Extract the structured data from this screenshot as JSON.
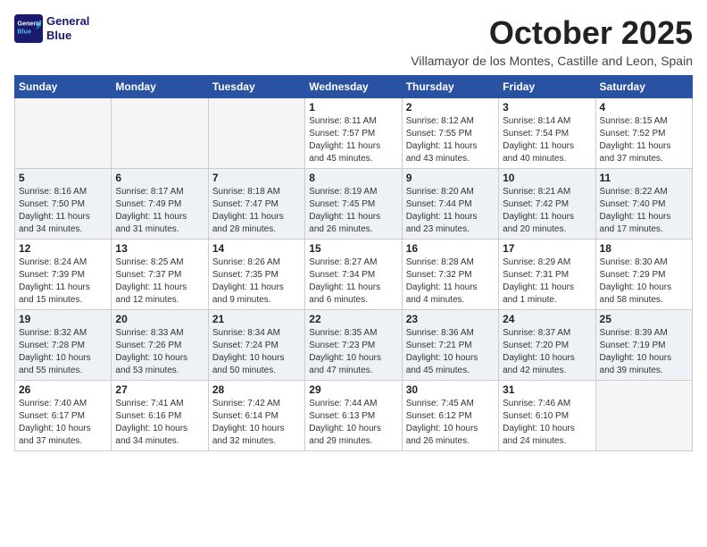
{
  "header": {
    "logo_line1": "General",
    "logo_line2": "Blue",
    "month_title": "October 2025",
    "subtitle": "Villamayor de los Montes, Castille and Leon, Spain"
  },
  "weekdays": [
    "Sunday",
    "Monday",
    "Tuesday",
    "Wednesday",
    "Thursday",
    "Friday",
    "Saturday"
  ],
  "weeks": [
    [
      {
        "day": "",
        "info": ""
      },
      {
        "day": "",
        "info": ""
      },
      {
        "day": "",
        "info": ""
      },
      {
        "day": "1",
        "info": "Sunrise: 8:11 AM\nSunset: 7:57 PM\nDaylight: 11 hours\nand 45 minutes."
      },
      {
        "day": "2",
        "info": "Sunrise: 8:12 AM\nSunset: 7:55 PM\nDaylight: 11 hours\nand 43 minutes."
      },
      {
        "day": "3",
        "info": "Sunrise: 8:14 AM\nSunset: 7:54 PM\nDaylight: 11 hours\nand 40 minutes."
      },
      {
        "day": "4",
        "info": "Sunrise: 8:15 AM\nSunset: 7:52 PM\nDaylight: 11 hours\nand 37 minutes."
      }
    ],
    [
      {
        "day": "5",
        "info": "Sunrise: 8:16 AM\nSunset: 7:50 PM\nDaylight: 11 hours\nand 34 minutes."
      },
      {
        "day": "6",
        "info": "Sunrise: 8:17 AM\nSunset: 7:49 PM\nDaylight: 11 hours\nand 31 minutes."
      },
      {
        "day": "7",
        "info": "Sunrise: 8:18 AM\nSunset: 7:47 PM\nDaylight: 11 hours\nand 28 minutes."
      },
      {
        "day": "8",
        "info": "Sunrise: 8:19 AM\nSunset: 7:45 PM\nDaylight: 11 hours\nand 26 minutes."
      },
      {
        "day": "9",
        "info": "Sunrise: 8:20 AM\nSunset: 7:44 PM\nDaylight: 11 hours\nand 23 minutes."
      },
      {
        "day": "10",
        "info": "Sunrise: 8:21 AM\nSunset: 7:42 PM\nDaylight: 11 hours\nand 20 minutes."
      },
      {
        "day": "11",
        "info": "Sunrise: 8:22 AM\nSunset: 7:40 PM\nDaylight: 11 hours\nand 17 minutes."
      }
    ],
    [
      {
        "day": "12",
        "info": "Sunrise: 8:24 AM\nSunset: 7:39 PM\nDaylight: 11 hours\nand 15 minutes."
      },
      {
        "day": "13",
        "info": "Sunrise: 8:25 AM\nSunset: 7:37 PM\nDaylight: 11 hours\nand 12 minutes."
      },
      {
        "day": "14",
        "info": "Sunrise: 8:26 AM\nSunset: 7:35 PM\nDaylight: 11 hours\nand 9 minutes."
      },
      {
        "day": "15",
        "info": "Sunrise: 8:27 AM\nSunset: 7:34 PM\nDaylight: 11 hours\nand 6 minutes."
      },
      {
        "day": "16",
        "info": "Sunrise: 8:28 AM\nSunset: 7:32 PM\nDaylight: 11 hours\nand 4 minutes."
      },
      {
        "day": "17",
        "info": "Sunrise: 8:29 AM\nSunset: 7:31 PM\nDaylight: 11 hours\nand 1 minute."
      },
      {
        "day": "18",
        "info": "Sunrise: 8:30 AM\nSunset: 7:29 PM\nDaylight: 10 hours\nand 58 minutes."
      }
    ],
    [
      {
        "day": "19",
        "info": "Sunrise: 8:32 AM\nSunset: 7:28 PM\nDaylight: 10 hours\nand 55 minutes."
      },
      {
        "day": "20",
        "info": "Sunrise: 8:33 AM\nSunset: 7:26 PM\nDaylight: 10 hours\nand 53 minutes."
      },
      {
        "day": "21",
        "info": "Sunrise: 8:34 AM\nSunset: 7:24 PM\nDaylight: 10 hours\nand 50 minutes."
      },
      {
        "day": "22",
        "info": "Sunrise: 8:35 AM\nSunset: 7:23 PM\nDaylight: 10 hours\nand 47 minutes."
      },
      {
        "day": "23",
        "info": "Sunrise: 8:36 AM\nSunset: 7:21 PM\nDaylight: 10 hours\nand 45 minutes."
      },
      {
        "day": "24",
        "info": "Sunrise: 8:37 AM\nSunset: 7:20 PM\nDaylight: 10 hours\nand 42 minutes."
      },
      {
        "day": "25",
        "info": "Sunrise: 8:39 AM\nSunset: 7:19 PM\nDaylight: 10 hours\nand 39 minutes."
      }
    ],
    [
      {
        "day": "26",
        "info": "Sunrise: 7:40 AM\nSunset: 6:17 PM\nDaylight: 10 hours\nand 37 minutes."
      },
      {
        "day": "27",
        "info": "Sunrise: 7:41 AM\nSunset: 6:16 PM\nDaylight: 10 hours\nand 34 minutes."
      },
      {
        "day": "28",
        "info": "Sunrise: 7:42 AM\nSunset: 6:14 PM\nDaylight: 10 hours\nand 32 minutes."
      },
      {
        "day": "29",
        "info": "Sunrise: 7:44 AM\nSunset: 6:13 PM\nDaylight: 10 hours\nand 29 minutes."
      },
      {
        "day": "30",
        "info": "Sunrise: 7:45 AM\nSunset: 6:12 PM\nDaylight: 10 hours\nand 26 minutes."
      },
      {
        "day": "31",
        "info": "Sunrise: 7:46 AM\nSunset: 6:10 PM\nDaylight: 10 hours\nand 24 minutes."
      },
      {
        "day": "",
        "info": ""
      }
    ]
  ]
}
